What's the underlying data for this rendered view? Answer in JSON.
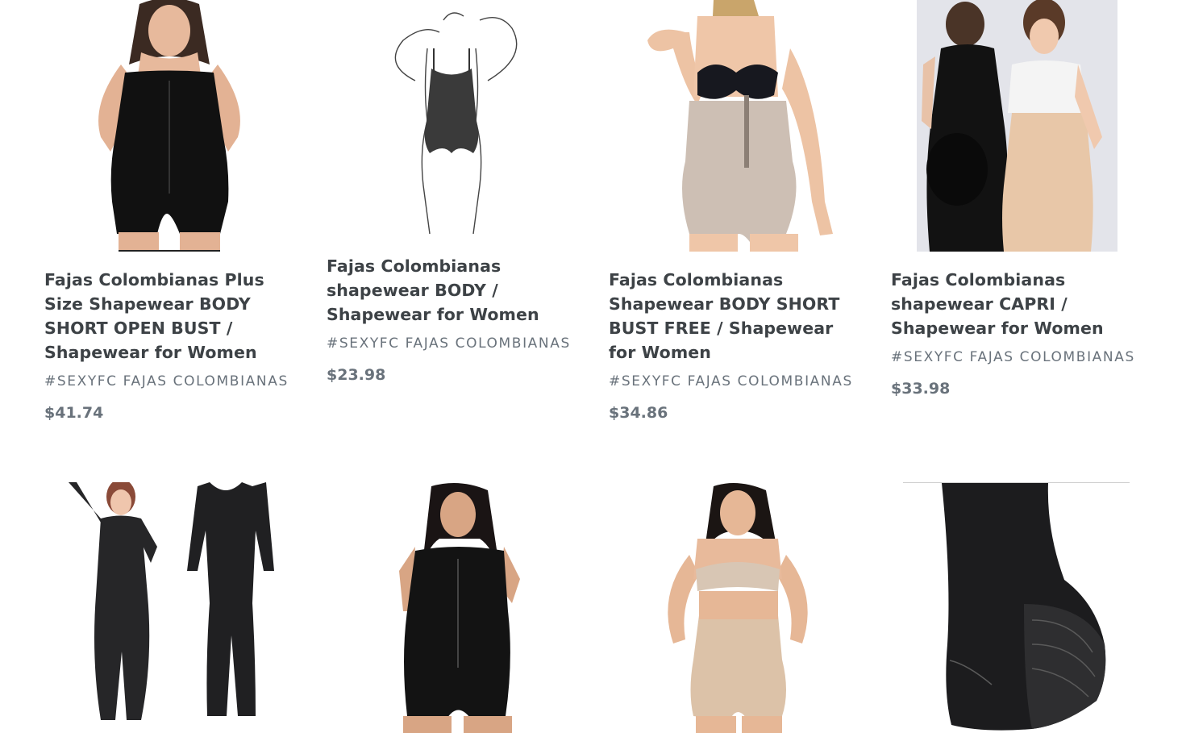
{
  "products": [
    {
      "title": "Fajas Colombianas Plus Size Shapewear BODY SHORT OPEN BUST / Shapewear for Women",
      "vendor": "#SEXYFC FAJAS COLOMBIANAS",
      "price": "$41.74",
      "image": "black-bodysuit-model-photo"
    },
    {
      "title": "Fajas Colombianas shapewear BODY / Shapewear for Women",
      "vendor": "#SEXYFC FAJAS COLOMBIANAS",
      "price": "$23.98",
      "image": "bodysuit-sketch-illustration"
    },
    {
      "title": "Fajas Colombianas Shapewear BODY SHORT BUST FREE / Shapewear for Women",
      "vendor": "#SEXYFC FAJAS COLOMBIANAS",
      "price": "$34.86",
      "image": "beige-bodysuit-model-photo"
    },
    {
      "title": "Fajas Colombianas shapewear CAPRI / Shapewear for Women",
      "vendor": "#SEXYFC FAJAS COLOMBIANAS",
      "price": "$33.98",
      "image": "capri-two-models-photo"
    },
    {
      "image": "long-sleeve-full-body-shaper-photo"
    },
    {
      "image": "black-zip-bodysuit-model-photo"
    },
    {
      "image": "beige-strapless-shaper-model-photo"
    },
    {
      "image": "black-lace-high-waist-panty-photo"
    }
  ]
}
